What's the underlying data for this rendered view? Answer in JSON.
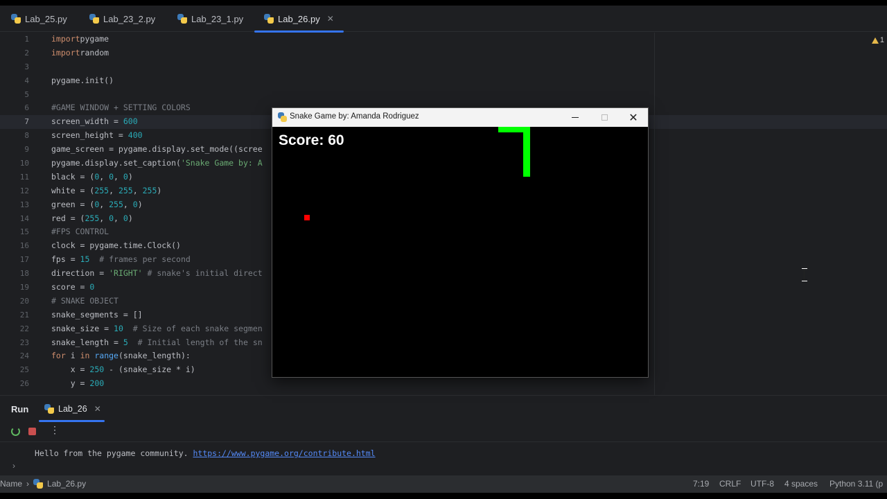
{
  "tabs": [
    {
      "label": "Lab_25.py",
      "active": false
    },
    {
      "label": "Lab_23_2.py",
      "active": false
    },
    {
      "label": "Lab_23_1.py",
      "active": false
    },
    {
      "label": "Lab_26.py",
      "active": true
    }
  ],
  "editor": {
    "current_line": 7,
    "warning_count": "1",
    "lines": [
      [
        [
          "kw",
          "import"
        ],
        [
          "",
          "pygame"
        ]
      ],
      [
        [
          "kw",
          "import"
        ],
        [
          "",
          "random"
        ]
      ],
      [],
      [
        [
          "",
          "pygame.init()"
        ]
      ],
      [],
      [
        [
          "cmt",
          "#GAME WINDOW + SETTING COLORS"
        ]
      ],
      [
        [
          "",
          "screen_width = "
        ],
        [
          "num",
          "600"
        ]
      ],
      [
        [
          "",
          "screen_height = "
        ],
        [
          "num",
          "400"
        ]
      ],
      [
        [
          "",
          "game_screen = pygame.display.set_mode((scree"
        ]
      ],
      [
        [
          "",
          "pygame.display.set_caption("
        ],
        [
          "str",
          "'Snake Game by: A"
        ]
      ],
      [
        [
          "",
          "black = ("
        ],
        [
          "num",
          "0"
        ],
        [
          "",
          ", "
        ],
        [
          "num",
          "0"
        ],
        [
          "",
          ", "
        ],
        [
          "num",
          "0"
        ],
        [
          "",
          ")"
        ]
      ],
      [
        [
          "",
          "white = ("
        ],
        [
          "num",
          "255"
        ],
        [
          "",
          ", "
        ],
        [
          "num",
          "255"
        ],
        [
          "",
          ", "
        ],
        [
          "num",
          "255"
        ],
        [
          "",
          ")"
        ]
      ],
      [
        [
          "",
          "green = ("
        ],
        [
          "num",
          "0"
        ],
        [
          "",
          ", "
        ],
        [
          "num",
          "255"
        ],
        [
          "",
          ", "
        ],
        [
          "num",
          "0"
        ],
        [
          "",
          ")"
        ]
      ],
      [
        [
          "",
          "red = ("
        ],
        [
          "num",
          "255"
        ],
        [
          "",
          ", "
        ],
        [
          "num",
          "0"
        ],
        [
          "",
          ", "
        ],
        [
          "num",
          "0"
        ],
        [
          "",
          ")"
        ]
      ],
      [
        [
          "cmt",
          "#FPS CONTROL"
        ]
      ],
      [
        [
          "",
          "clock = pygame.time.Clock()"
        ]
      ],
      [
        [
          "",
          "fps = "
        ],
        [
          "num",
          "15"
        ],
        [
          "",
          "  "
        ],
        [
          "cmt",
          "# frames per second"
        ]
      ],
      [
        [
          "",
          "direction = "
        ],
        [
          "str",
          "'RIGHT'"
        ],
        [
          "cmt",
          " # snake's initial direct"
        ]
      ],
      [
        [
          "",
          "score = "
        ],
        [
          "num",
          "0"
        ]
      ],
      [
        [
          "cmt",
          "# SNAKE OBJECT"
        ]
      ],
      [
        [
          "",
          "snake_segments = []"
        ]
      ],
      [
        [
          "",
          "snake_size = "
        ],
        [
          "num",
          "10"
        ],
        [
          "",
          "  "
        ],
        [
          "cmt",
          "# Size of each snake segmen"
        ]
      ],
      [
        [
          "",
          "snake_length = "
        ],
        [
          "num",
          "5"
        ],
        [
          "",
          "  "
        ],
        [
          "cmt",
          "# Initial length of the sn"
        ]
      ],
      [
        [
          "kw",
          "for"
        ],
        [
          "",
          " i "
        ],
        [
          "kw",
          "in"
        ],
        [
          "",
          " "
        ],
        [
          "fn",
          "range"
        ],
        [
          "",
          "(snake_length):"
        ]
      ],
      [
        [
          "",
          "    x = "
        ],
        [
          "num",
          "250"
        ],
        [
          "",
          " - (snake_size * i)"
        ]
      ],
      [
        [
          "",
          "    y = "
        ],
        [
          "num",
          "200"
        ]
      ]
    ]
  },
  "game_window": {
    "title": "Snake Game by: Amanda Rodriguez",
    "score_text": "Score: 60",
    "snake_color": "#00ff00",
    "food_color": "#ff0000"
  },
  "run_panel": {
    "title": "Run",
    "tab_label": "Lab_26",
    "console_text": "Hello from the pygame community. ",
    "console_link": "https://www.pygame.org/contribute.html"
  },
  "status_bar": {
    "breadcrumb_root": "Name",
    "file": "Lab_26.py",
    "position": "7:19",
    "line_sep": "CRLF",
    "encoding": "UTF-8",
    "indent": "4 spaces",
    "interpreter": "Python 3.11 (p"
  }
}
